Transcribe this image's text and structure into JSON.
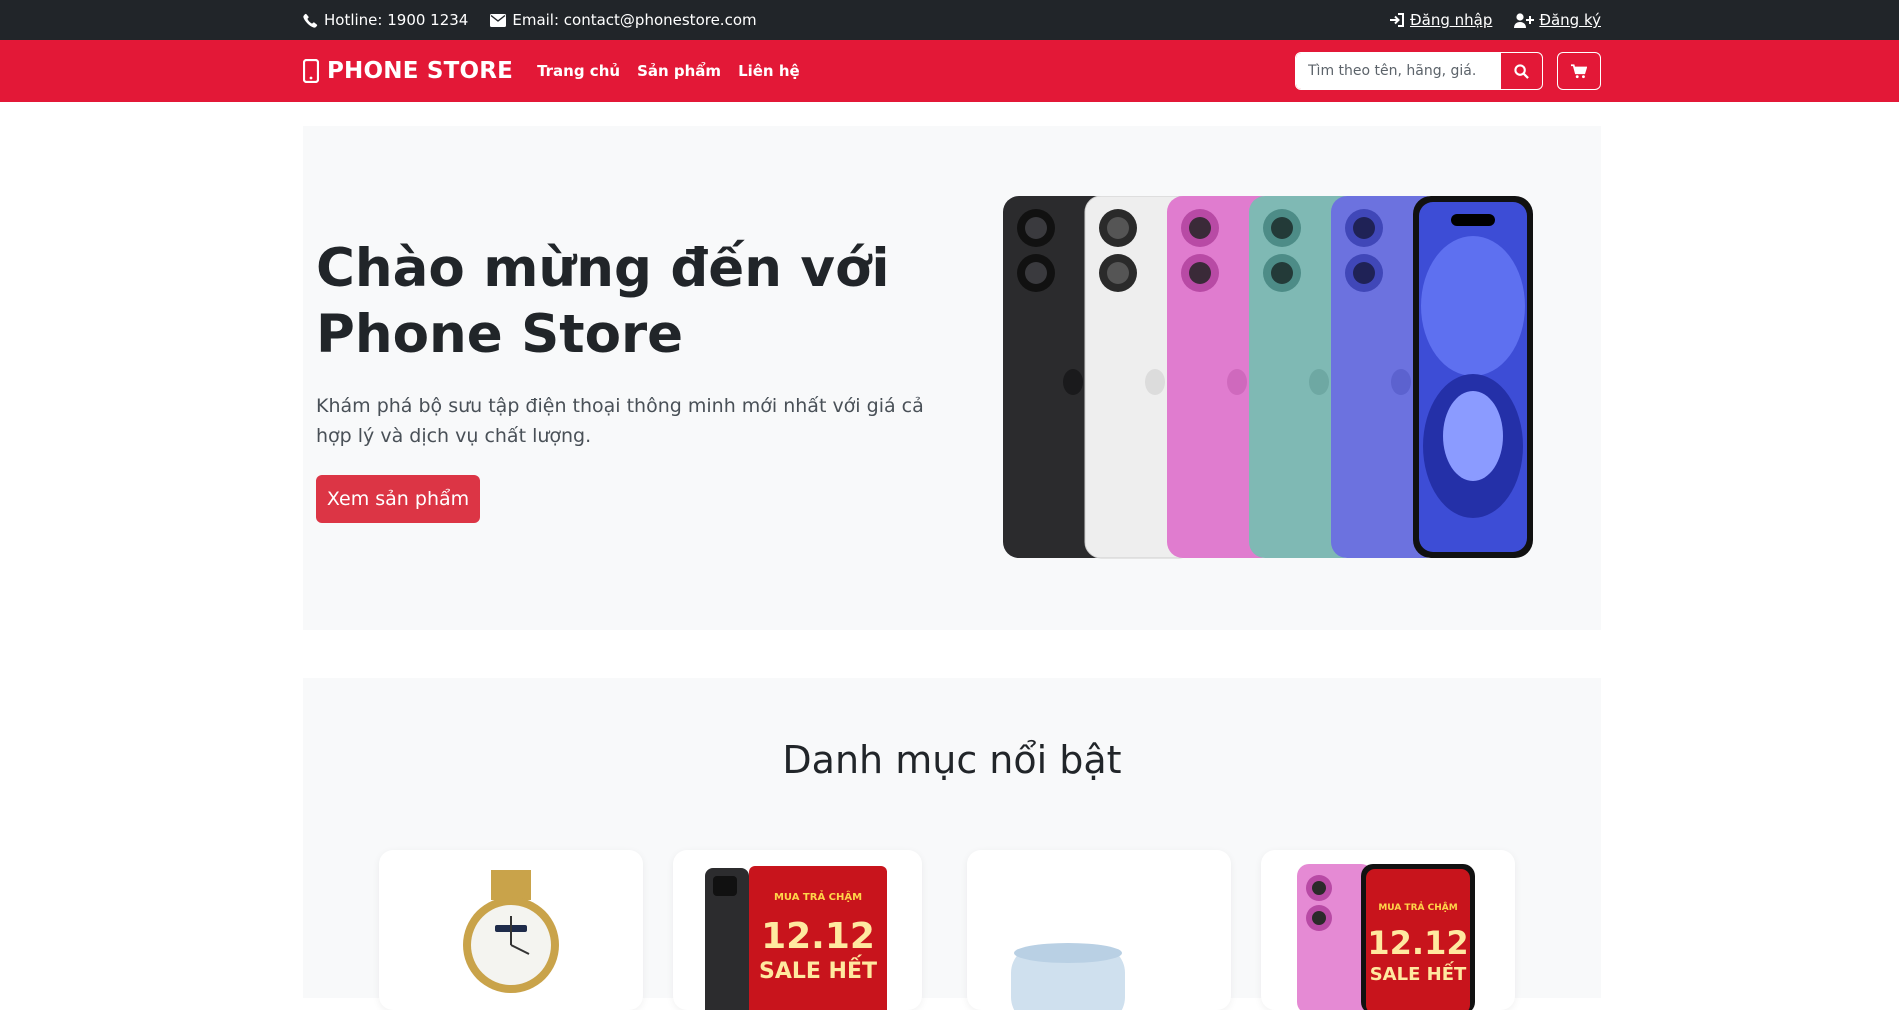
{
  "topbar": {
    "hotline": "Hotline: 1900 1234",
    "email": "Email: contact@phonestore.com",
    "login": "Đăng nhập",
    "register": "Đăng ký"
  },
  "navbar": {
    "brand": "PHONE STORE",
    "links": [
      "Trang chủ",
      "Sản phẩm",
      "Liên hệ"
    ],
    "search_placeholder": "Tìm theo tên, hãng, giá."
  },
  "hero": {
    "title": "Chào mừng đến với Phone Store",
    "subtitle": "Khám phá bộ sưu tập điện thoại thông minh mới nhất với giá cả hợp lý và dịch vụ chất lượng.",
    "cta": "Xem sản phẩm",
    "phone_colors": [
      "#2b2b2d",
      "#eeeeee",
      "#e07ccf",
      "#7fb9b4",
      "#6c72df",
      "#3d4dd6"
    ]
  },
  "categories": {
    "title": "Danh mục nổi bật",
    "promo_text_top": "MUA TRẢ CHẬM",
    "promo_text_big": "12.12",
    "promo_text_sale": "SALE HẾT"
  },
  "colors": {
    "topbar": "#212529",
    "brand_red": "#e31837",
    "button_red": "#dc3545"
  }
}
